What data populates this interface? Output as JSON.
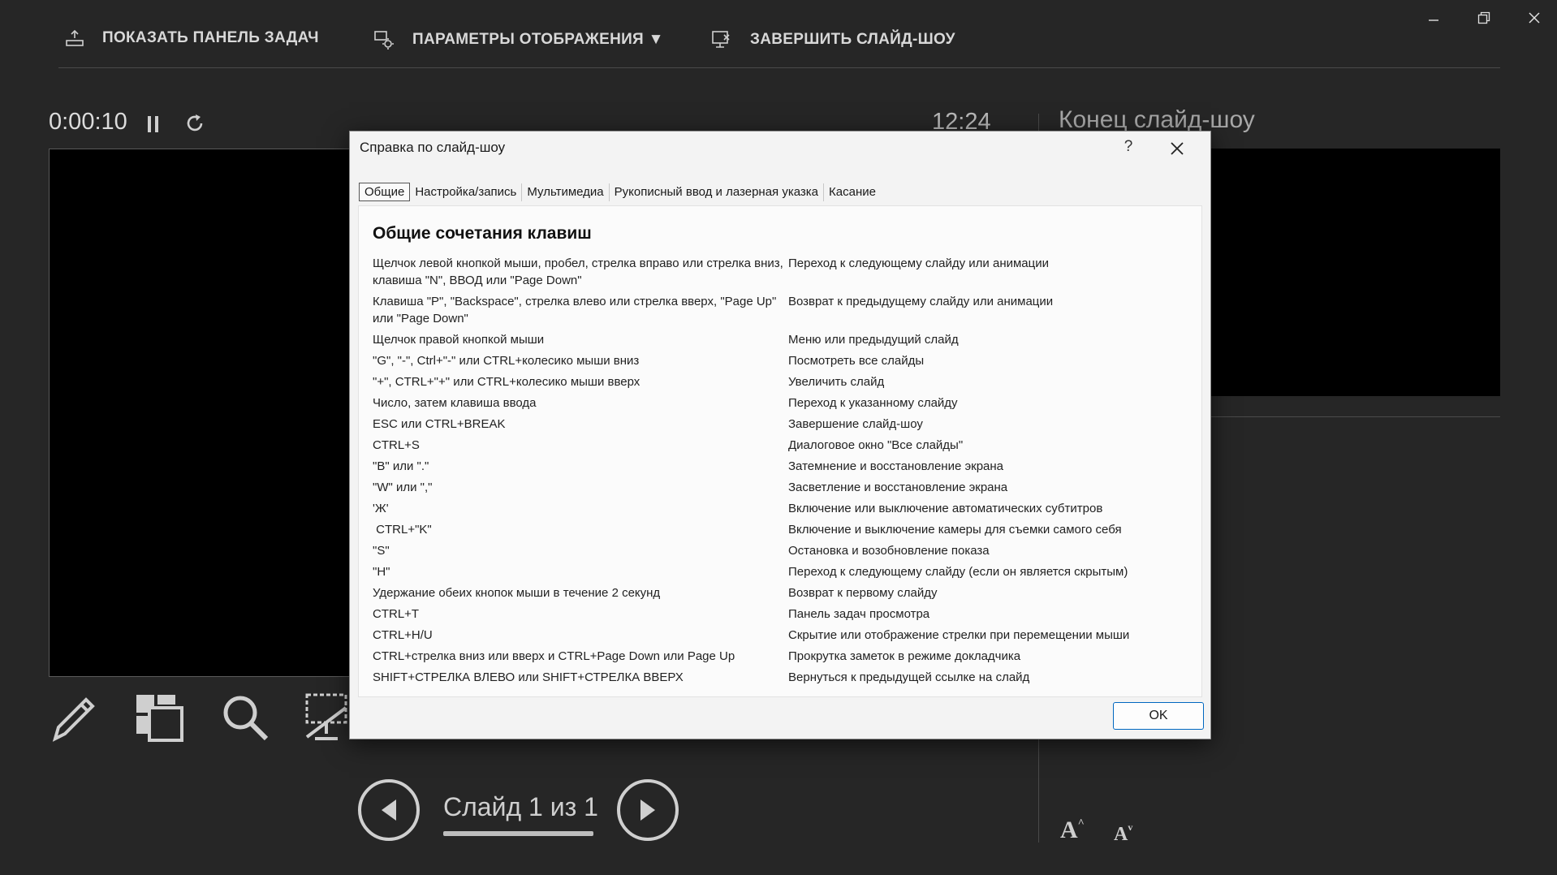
{
  "topbar": {
    "show_taskbar": "ПОКАЗАТЬ ПАНЕЛЬ ЗАДАЧ",
    "display_settings": "ПАРАМЕТРЫ ОТОБРАЖЕНИЯ ▼",
    "end_show": "ЗАВЕРШИТЬ СЛАЙД-ШОУ"
  },
  "presenter": {
    "timer": "0:00:10",
    "clock": "12:24",
    "next_label": "Конец слайд-шоу",
    "slide_counter": "Слайд 1 из 1"
  },
  "dialog": {
    "title": "Справка по слайд-шоу",
    "help": "?",
    "tabs": [
      {
        "label": "Общие"
      },
      {
        "label": "Настройка/запись"
      },
      {
        "label": "Мультимедиа"
      },
      {
        "label": "Рукописный ввод и лазерная указка"
      },
      {
        "label": "Касание"
      }
    ],
    "heading": "Общие сочетания клавиш",
    "shortcuts": [
      {
        "keys": "Щелчок левой кнопкой мыши, пробел, стрелка вправо или стрелка вниз, клавиша \"N\", ВВОД или \"Page Down\"",
        "desc": "Переход к следующему слайду или анимации"
      },
      {
        "keys": "Клавиша \"P\", \"Backspace\", стрелка влево или стрелка вверх, \"Page Up\" или \"Page Down\"",
        "desc": "Возврат к предыдущему слайду или анимации"
      },
      {
        "keys": "Щелчок правой кнопкой мыши",
        "desc": "Меню или предыдущий слайд"
      },
      {
        "keys": "\"G\", \"-\", Ctrl+\"-\" или CTRL+колесико мыши вниз",
        "desc": "Посмотреть все слайды"
      },
      {
        "keys": "\"+\", CTRL+\"+\" или CTRL+колесико мыши вверх",
        "desc": "Увеличить слайд"
      },
      {
        "keys": "Число, затем клавиша ввода",
        "desc": "Переход к указанному слайду"
      },
      {
        "keys": "ESC или CTRL+BREAK",
        "desc": "Завершение слайд-шоу"
      },
      {
        "keys": "CTRL+S",
        "desc": "Диалоговое окно \"Все слайды\""
      },
      {
        "keys": "\"B\" или \".\"",
        "desc": "Затемнение и восстановление экрана"
      },
      {
        "keys": "\"W\" или \",\"",
        "desc": "Засветление и восстановление экрана"
      },
      {
        "keys": "'Ж'",
        "desc": "Включение или выключение автоматических субтитров"
      },
      {
        "keys": " CTRL+\"K\"",
        "desc": "Включение и выключение камеры для съемки самого себя"
      },
      {
        "keys": "\"S\"",
        "desc": "Остановка и возобновление показа"
      },
      {
        "keys": "\"H\"",
        "desc": "Переход к следующему слайду (если он является скрытым)"
      },
      {
        "keys": "Удержание обеих кнопок мыши в течение 2 секунд",
        "desc": "Возврат к первому слайду"
      },
      {
        "keys": "CTRL+T",
        "desc": "Панель задач просмотра"
      },
      {
        "keys": "CTRL+H/U",
        "desc": "Скрытие или отображение стрелки при перемещении мыши"
      },
      {
        "keys": "CTRL+стрелка вниз или вверх и CTRL+Page Down или Page Up",
        "desc": "Прокрутка заметок в режиме докладчика"
      },
      {
        "keys": "SHIFT+СТРЕЛКА ВЛЕВО или SHIFT+СТРЕЛКА ВВЕРХ",
        "desc": "Вернуться к предыдущей ссылке на слайд"
      }
    ],
    "ok": "OK"
  },
  "icons": {
    "taskbar": "taskbar-icon",
    "settings": "display-settings-icon",
    "end": "end-show-icon",
    "pen": "pen-icon",
    "see_all": "see-all-slides-icon",
    "zoom": "zoom-icon",
    "black_screen": "black-screen-icon"
  }
}
